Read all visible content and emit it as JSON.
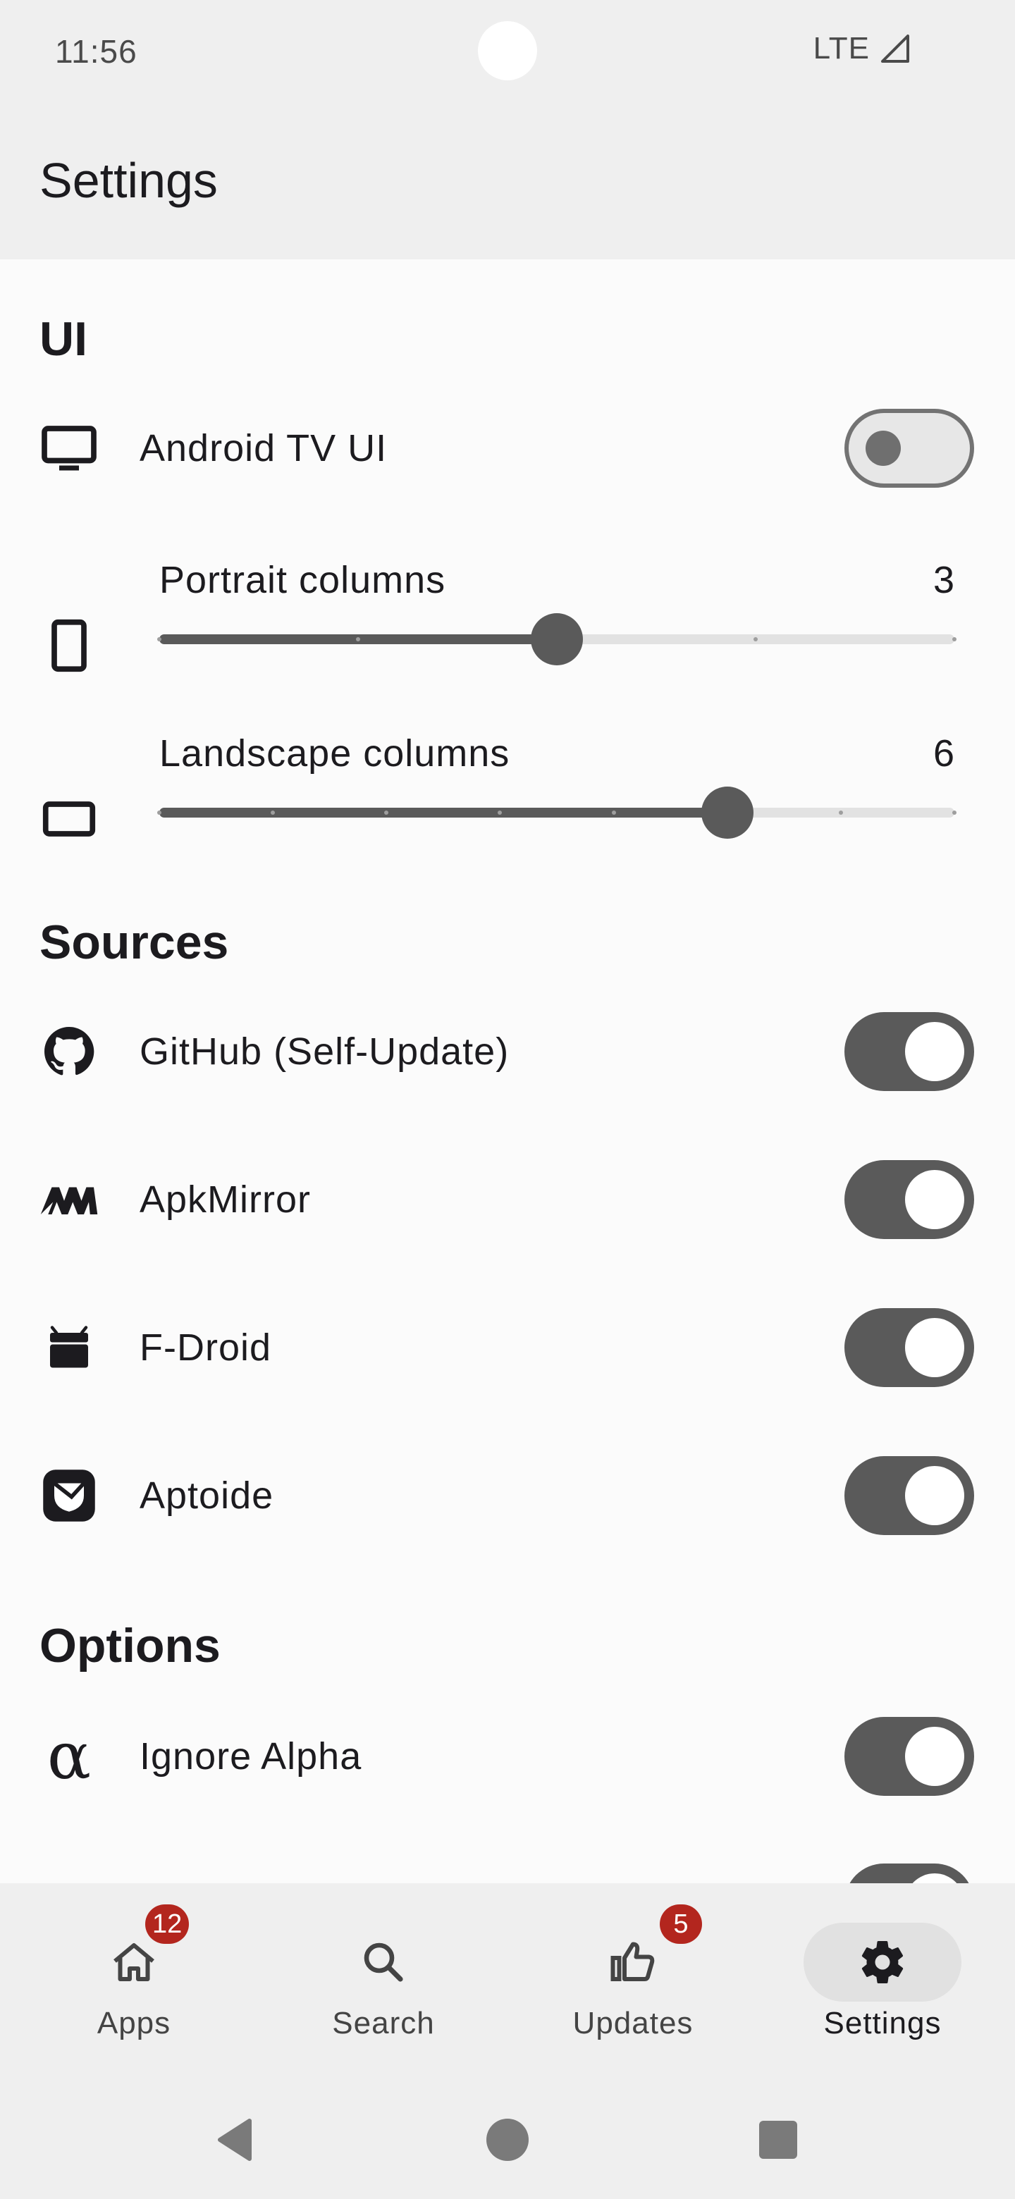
{
  "status_bar": {
    "time": "11:56",
    "network": "LTE"
  },
  "app_bar": {
    "title": "Settings"
  },
  "sections": {
    "ui": {
      "header": "UI",
      "android_tv": {
        "label": "Android TV UI",
        "enabled": false,
        "icon": "tv-icon"
      },
      "portrait": {
        "label": "Portrait columns",
        "value": "3",
        "min": 1,
        "max": 5,
        "current": 3,
        "icon": "phone-portrait-icon"
      },
      "landscape": {
        "label": "Landscape columns",
        "value": "6",
        "min": 1,
        "max": 8,
        "current": 6,
        "icon": "phone-landscape-icon"
      }
    },
    "sources": {
      "header": "Sources",
      "items": [
        {
          "label": "GitHub (Self-Update)",
          "enabled": true,
          "icon": "github-icon"
        },
        {
          "label": "ApkMirror",
          "enabled": true,
          "icon": "apkmirror-icon"
        },
        {
          "label": "F-Droid",
          "enabled": true,
          "icon": "fdroid-icon"
        },
        {
          "label": "Aptoide",
          "enabled": true,
          "icon": "aptoide-icon"
        }
      ]
    },
    "options": {
      "header": "Options",
      "items": [
        {
          "label": "Ignore Alpha",
          "enabled": true,
          "icon": "alpha-icon"
        }
      ]
    }
  },
  "bottom_nav": {
    "items": [
      {
        "label": "Apps",
        "badge": "12",
        "icon": "home-icon",
        "active": false
      },
      {
        "label": "Search",
        "badge": "",
        "icon": "search-icon",
        "active": false
      },
      {
        "label": "Updates",
        "badge": "5",
        "icon": "thumb-up-icon",
        "active": false
      },
      {
        "label": "Settings",
        "badge": "",
        "icon": "gear-icon",
        "active": true
      }
    ]
  },
  "colors": {
    "accent": "#5a5a5a",
    "badge": "#b3261e",
    "bar_background": "#efefef",
    "page_background": "#fbfbfb"
  }
}
